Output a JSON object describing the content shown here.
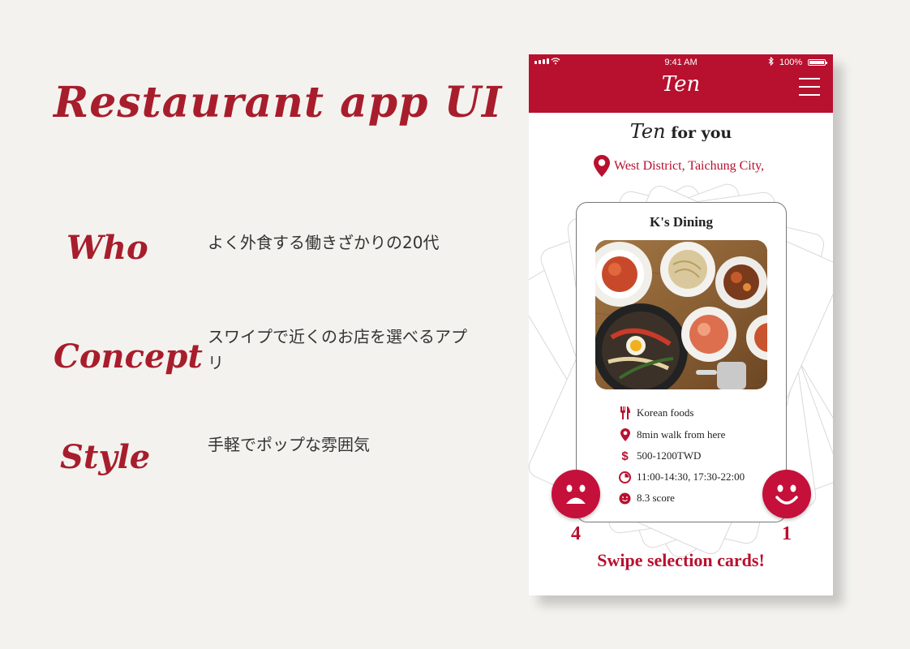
{
  "title": "Restaurant app UI",
  "rows": [
    {
      "label": "Who",
      "text": "よく外食する働きざかりの20代"
    },
    {
      "label": "Concept",
      "text": "スワイプで近くのお店を選べるアプリ"
    },
    {
      "label": "Style",
      "text": "手軽でポップな雰囲気"
    }
  ],
  "phone": {
    "status": {
      "time": "9:41 AM",
      "battery": "100%"
    },
    "app_name": "Ten",
    "heading": {
      "logo": "Ten",
      "rest": " for you"
    },
    "location": "West District, Taichung City,",
    "card": {
      "name": "K's Dining",
      "image": "korean-food-photo",
      "info": {
        "cuisine": "Korean foods",
        "distance": "8min walk from here",
        "price": "500-1200TWD",
        "hours": "11:00-14:30, 17:30-22:00",
        "score": "8.3 score"
      }
    },
    "dislike_count": "4",
    "like_count": "1",
    "footer": "Swipe selection cards!"
  },
  "colors": {
    "accent": "#b8102f",
    "background": "#f3f2ee"
  }
}
